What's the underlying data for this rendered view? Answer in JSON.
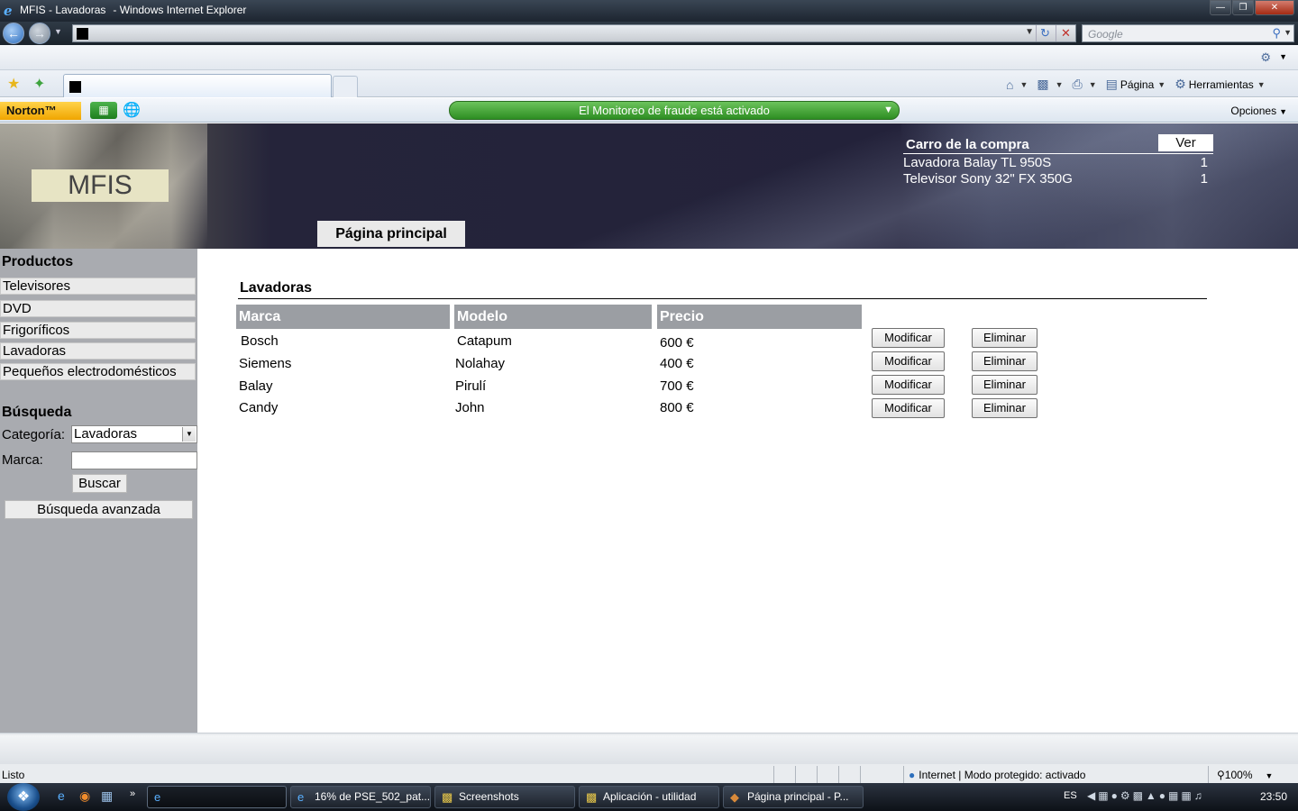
{
  "window": {
    "title": "MFIS -  Lavadoras",
    "app_suffix": "- Windows Internet Explorer",
    "min": "—",
    "max": "❐",
    "close": "✕"
  },
  "browser": {
    "search_placeholder": "Google",
    "commands": {
      "pagina": "Página",
      "herramientas": "Herramientas"
    }
  },
  "norton": {
    "logo": "Norton™",
    "fraud_text": "El Monitoreo de fraude está activado",
    "options": "Opciones"
  },
  "site": {
    "logo": "MFIS",
    "home_tab": "Página principal",
    "cart": {
      "title": "Carro de la compra",
      "view_button": "Ver",
      "items": [
        {
          "name": "Lavadora Balay TL 950S",
          "qty": "1"
        },
        {
          "name": "Televisor Sony 32\" FX 350G",
          "qty": "1"
        }
      ]
    },
    "sidebar": {
      "products_heading": "Productos",
      "categories": [
        "Televisores",
        "DVD",
        "Frigoríficos",
        "Lavadoras",
        "Pequeños electrodomésticos"
      ],
      "search_heading": "Búsqueda",
      "category_label": "Categoría:",
      "category_value": "Lavadoras",
      "brand_label": "Marca:",
      "brand_value": "",
      "search_button": "Buscar",
      "advanced_button": "Búsqueda avanzada"
    },
    "main": {
      "title": "Lavadoras",
      "columns": [
        "Marca",
        "Modelo",
        "Precio"
      ],
      "rows": [
        {
          "marca": "Bosch",
          "modelo": "Catapum",
          "precio": "600 €"
        },
        {
          "marca": "Siemens",
          "modelo": "Nolahay",
          "precio": "400 €"
        },
        {
          "marca": "Balay",
          "modelo": "Pirulí",
          "precio": "700 €"
        },
        {
          "marca": "Candy",
          "modelo": "John",
          "precio": "800 €"
        }
      ],
      "modify_label": "Modificar",
      "delete_label": "Eliminar"
    }
  },
  "status": {
    "text": "Listo",
    "zone": "Internet | Modo protegido: activado",
    "zoom": "100%"
  },
  "taskbar": {
    "items": [
      "16% de PSE_502_pat...",
      "Screenshots",
      "Aplicación - utilidad",
      "Página principal - P..."
    ],
    "lang": "ES",
    "time": "23:50"
  }
}
